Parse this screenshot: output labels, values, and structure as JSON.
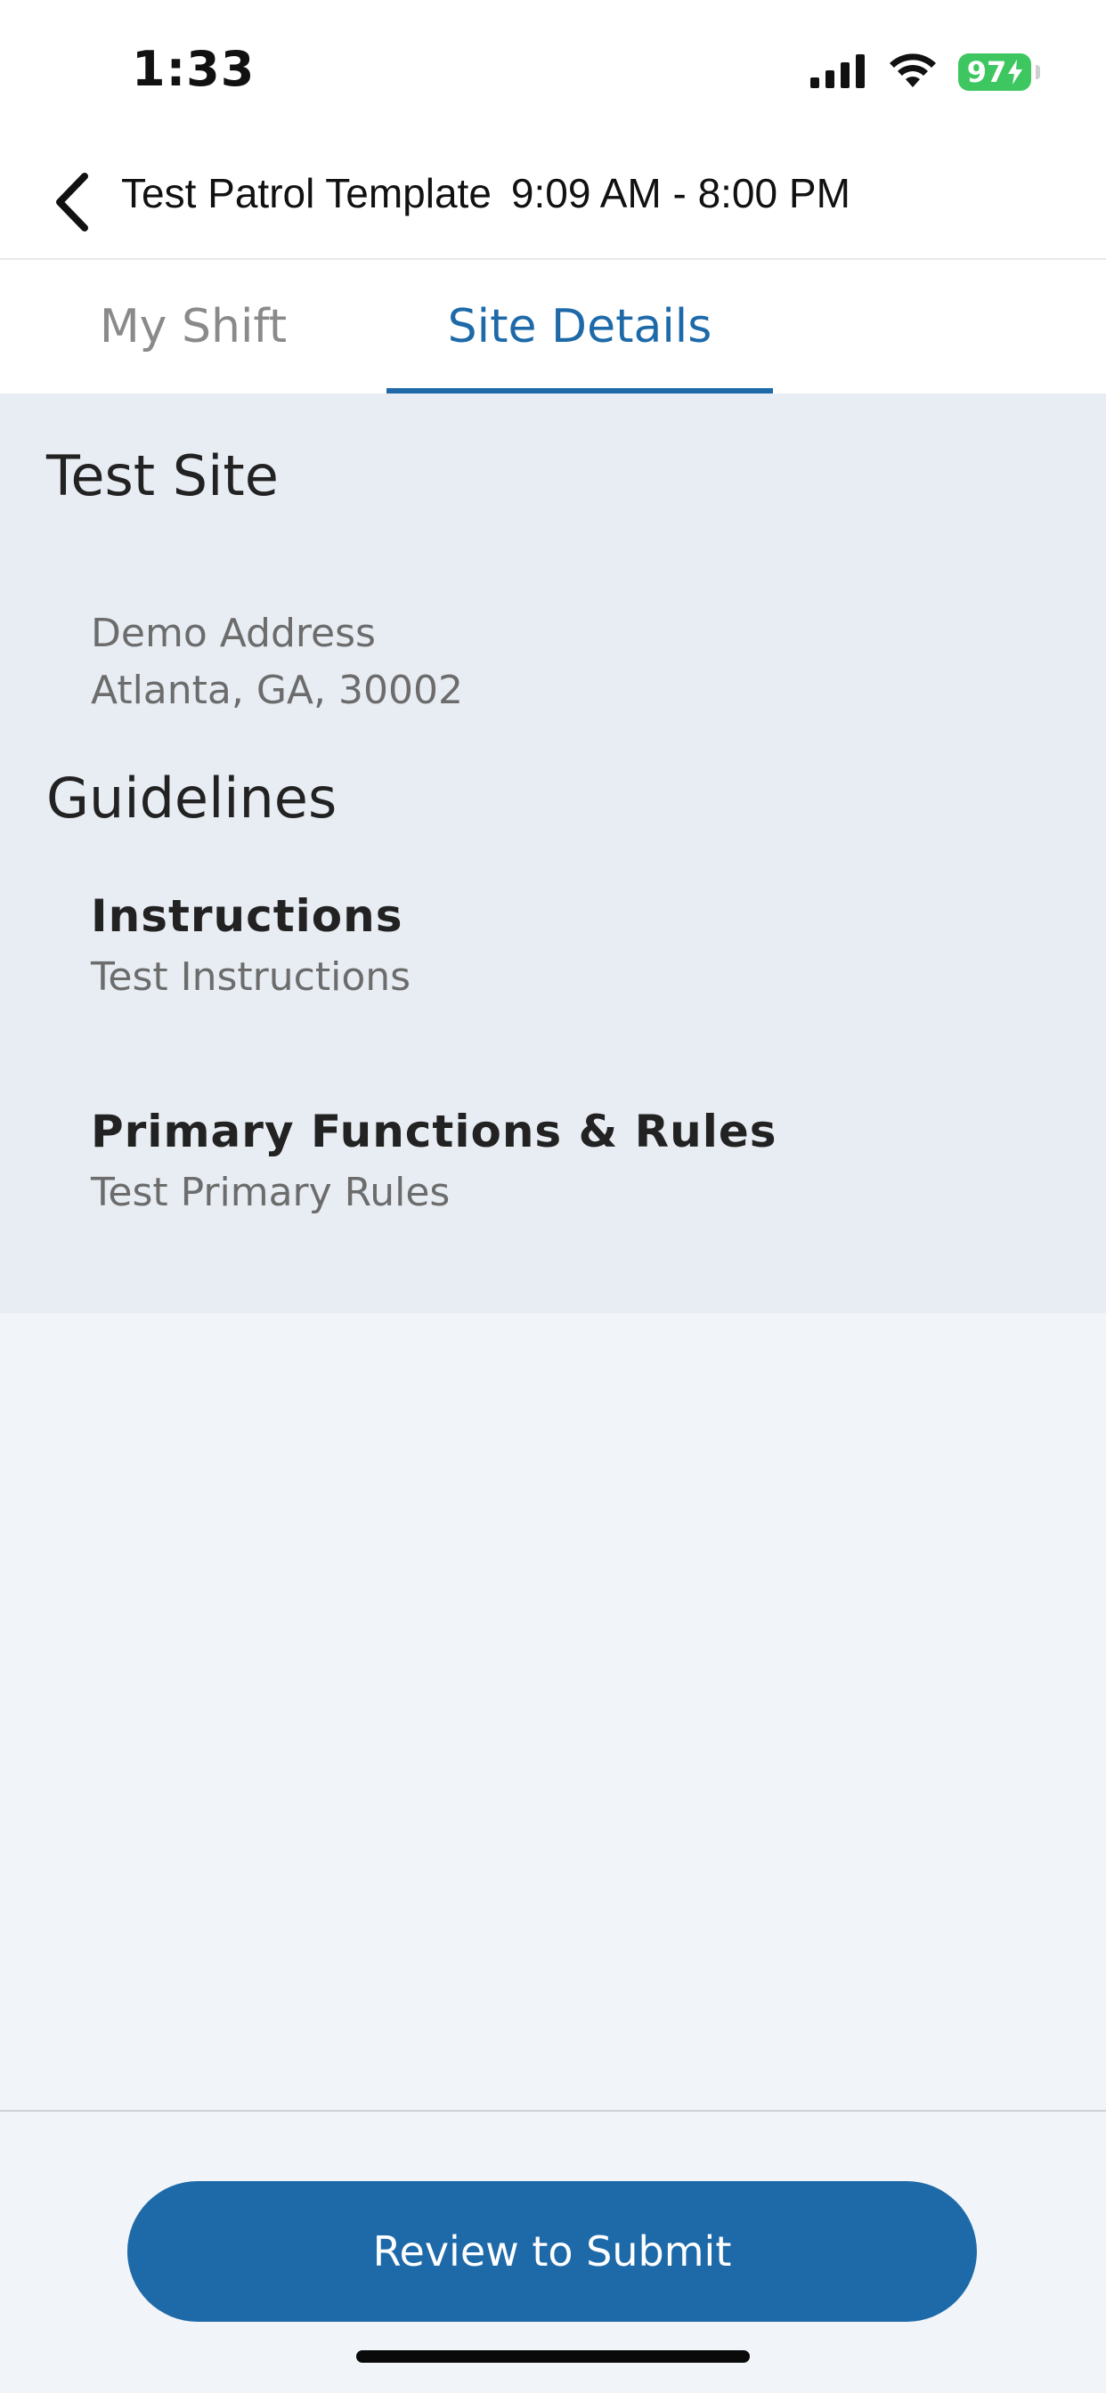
{
  "status_bar": {
    "time": "1:33",
    "battery_level": "97"
  },
  "header": {
    "title": "Test Patrol Template",
    "time_range": "9:09 AM - 8:00 PM"
  },
  "tabs": [
    {
      "label": "My Shift",
      "active": false
    },
    {
      "label": "Site Details",
      "active": true
    }
  ],
  "site": {
    "name": "Test Site",
    "address_line1": "Demo Address",
    "address_line2": "Atlanta, GA, 30002"
  },
  "guidelines": {
    "title": "Guidelines",
    "sections": [
      {
        "heading": "Instructions",
        "text": "Test Instructions"
      },
      {
        "heading": "Primary Functions & Rules",
        "text": "Test Primary Rules"
      }
    ]
  },
  "footer": {
    "submit_label": "Review to Submit"
  },
  "colors": {
    "accent": "#1e6aa9",
    "battery": "#3ec760",
    "panel": "#e8edf3",
    "background": "#f1f4f8"
  }
}
